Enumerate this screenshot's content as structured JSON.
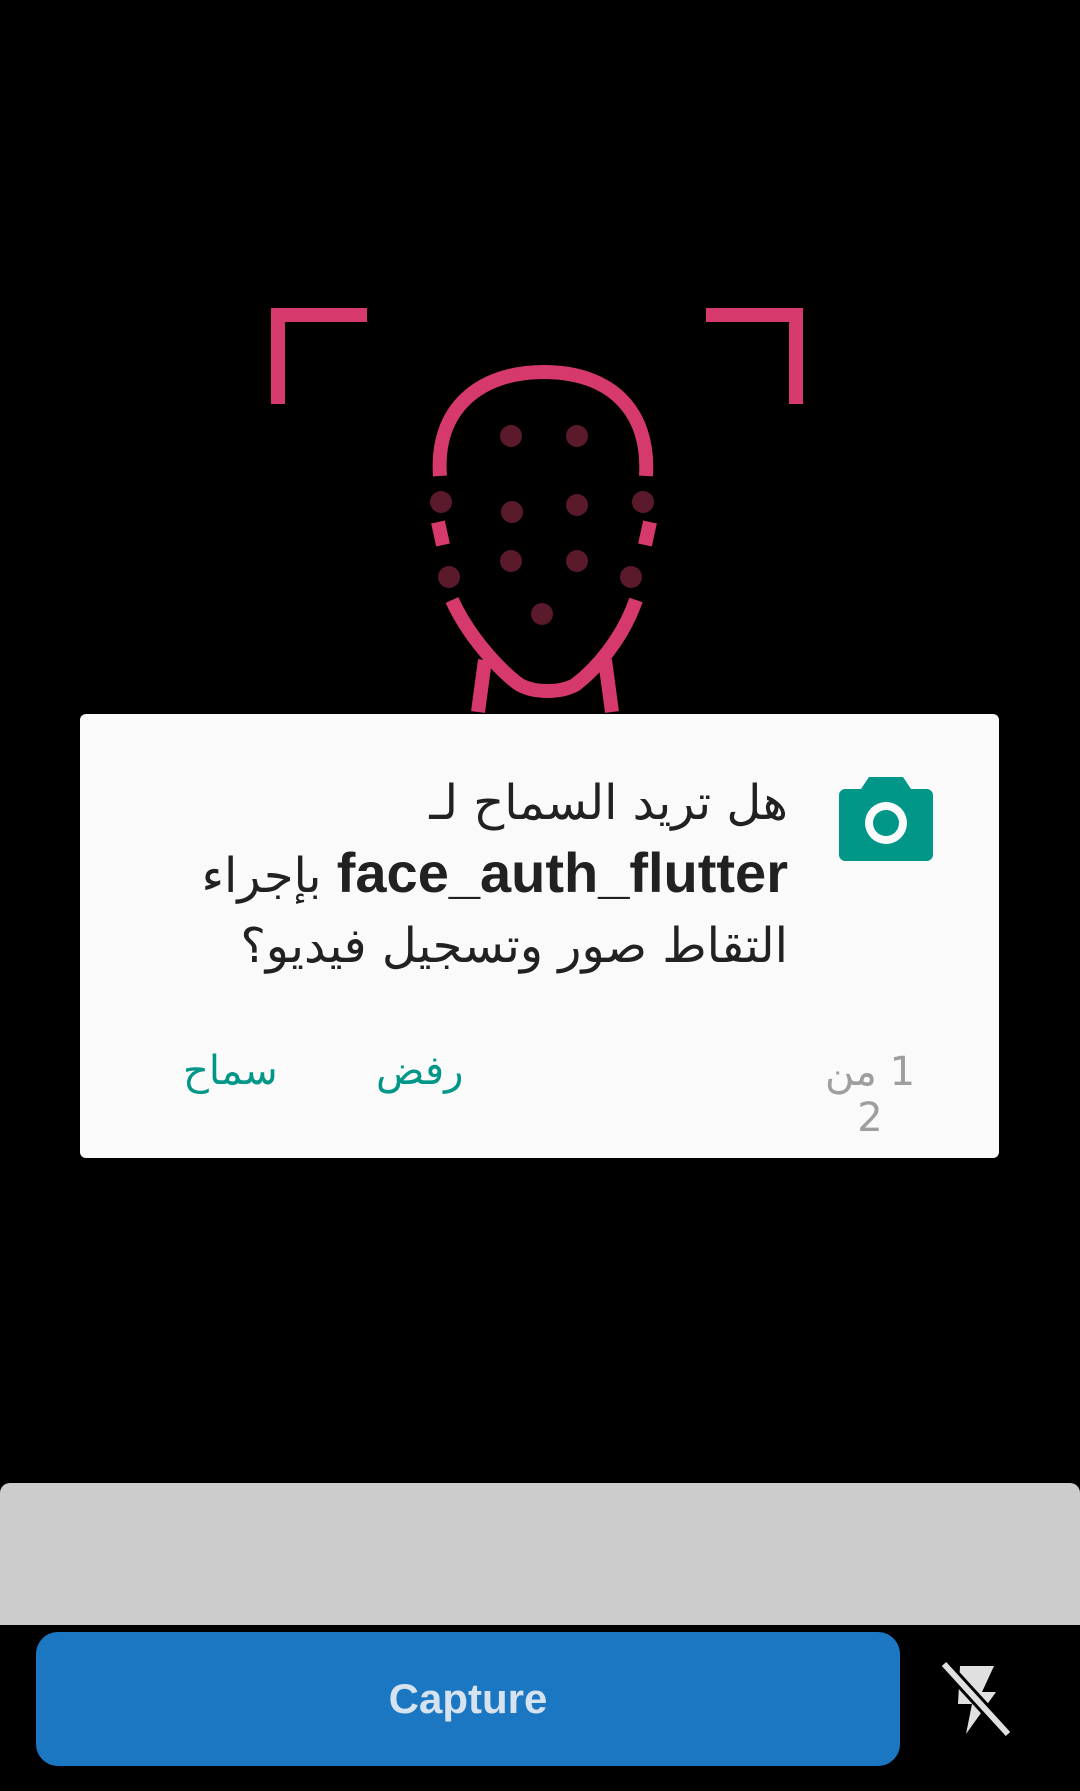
{
  "permission_dialog": {
    "message_line1": "هل تريد السماح لـ",
    "app_name": "face_auth_flutter",
    "message_rest": "بإجراء التقاط صور وتسجيل فيديو؟",
    "counter": "1 من 2",
    "deny_label": "رفض",
    "allow_label": "سماح",
    "icon": "camera-icon",
    "accent_color": "#009688"
  },
  "camera_controls": {
    "capture_label": "Capture",
    "flash_icon": "flash-off-icon",
    "capture_color": "#1c77c3"
  },
  "illustration": {
    "icon": "face-scan-icon",
    "accent_color": "#d63a6c"
  }
}
